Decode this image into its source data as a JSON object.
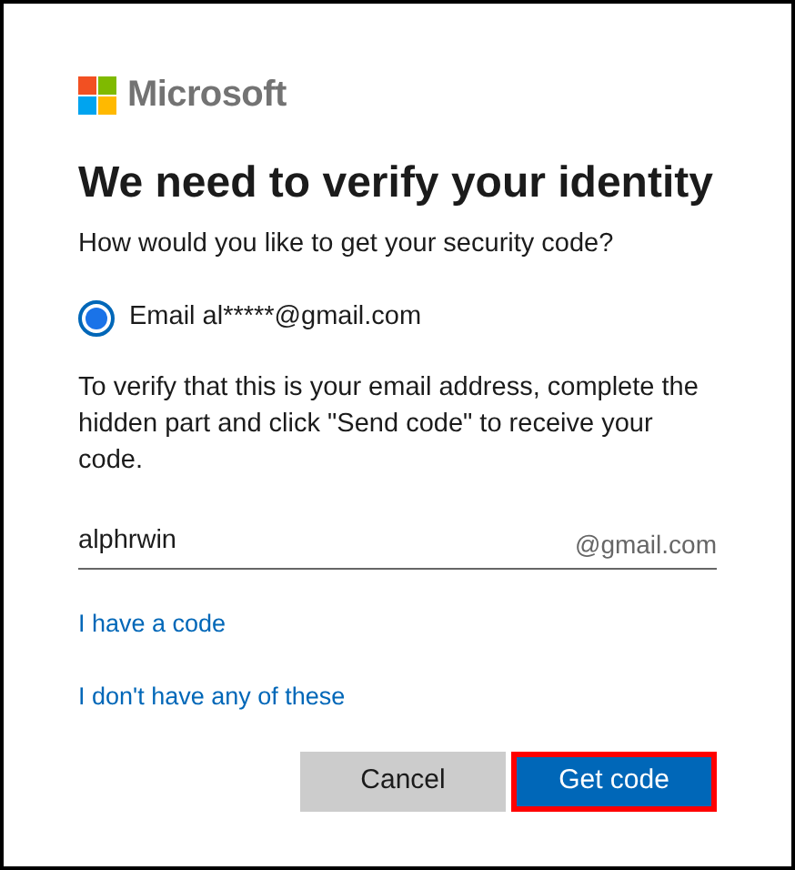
{
  "brand": {
    "name": "Microsoft"
  },
  "title": "We need to verify your identity",
  "prompt": "How would you like to get your security code?",
  "options": [
    {
      "label": "Email al*****@gmail.com",
      "selected": true
    }
  ],
  "instructions": "To verify that this is your email address, complete the hidden part and click \"Send code\" to receive your code.",
  "email_field": {
    "value": "alphrwin",
    "suffix": "@gmail.com"
  },
  "links": [
    "I have a code",
    "I don't have any of these"
  ],
  "buttons": [
    {
      "label": "Cancel",
      "kind": "secondary",
      "highlighted": false
    },
    {
      "label": "Get code",
      "kind": "primary",
      "highlighted": true
    }
  ]
}
